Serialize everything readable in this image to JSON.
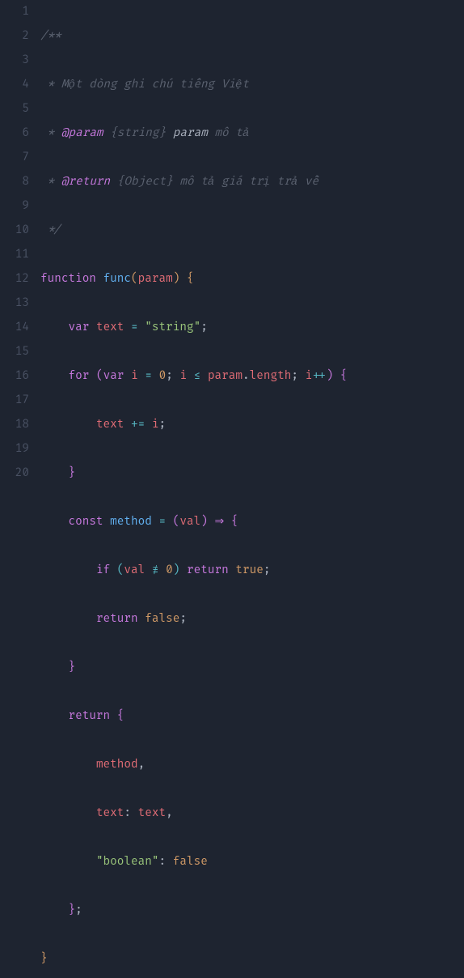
{
  "lines": {
    "n1": "1",
    "n2": "2",
    "n3": "3",
    "n4": "4",
    "n5": "5",
    "n6": "6",
    "n7": "7",
    "n8": "8",
    "n9": "9",
    "n10": "10",
    "n11": "11",
    "n12": "12",
    "n13": "13",
    "n14": "14",
    "n15": "15",
    "n16": "16",
    "n17": "17",
    "n18": "18",
    "n19": "19",
    "n20": "20"
  },
  "t": {
    "l1a": "/**",
    "l2a": " * Một dòng ghi chú tiếng Việt",
    "l3a": " * ",
    "l3b": "@param",
    "l3c": " ",
    "l3d": "{string}",
    "l3e": " ",
    "l3f": "param",
    "l3g": " mô tả",
    "l4a": " * ",
    "l4b": "@return",
    "l4c": " ",
    "l4d": "{Object}",
    "l4e": " mô tả giá trị trả về",
    "l5a": " */",
    "l6a": "function",
    "l6b": " ",
    "l6c": "func",
    "l6d": "(",
    "l6e": "param",
    "l6f": ")",
    "l6g": " ",
    "l6h": "{",
    "l7a": "    ",
    "l7b": "var",
    "l7c": " ",
    "l7d": "text",
    "l7e": " ",
    "l7f": "=",
    "l7g": " ",
    "l7h": "\"string\"",
    "l7i": ";",
    "l8a": "    ",
    "l8b": "for",
    "l8c": " ",
    "l8d": "(",
    "l8e": "var",
    "l8f": " ",
    "l8g": "i",
    "l8h": " ",
    "l8i": "=",
    "l8j": " ",
    "l8k": "0",
    "l8l": ";",
    "l8m": " ",
    "l8n": "i",
    "l8o": " ",
    "l8p": "≤",
    "l8q": " ",
    "l8r": "param",
    "l8s": ".",
    "l8t": "length",
    "l8u": ";",
    "l8v": " ",
    "l8w": "i",
    "l8x": "++",
    "l8y": ")",
    "l8z": " ",
    "l8aa": "{",
    "l9a": "        ",
    "l9b": "text",
    "l9c": " ",
    "l9d": "+=",
    "l9e": " ",
    "l9f": "i",
    "l9g": ";",
    "l10a": "    ",
    "l10b": "}",
    "l11a": "    ",
    "l11b": "const",
    "l11c": " ",
    "l11d": "method",
    "l11e": " ",
    "l11f": "=",
    "l11g": " ",
    "l11h": "(",
    "l11i": "val",
    "l11j": ")",
    "l11k": " ",
    "l11l": "⇒",
    "l11m": " ",
    "l11n": "{",
    "l12a": "        ",
    "l12b": "if",
    "l12c": " ",
    "l12d": "(",
    "l12e": "val",
    "l12f": " ",
    "l12g": "≢",
    "l12h": " ",
    "l12i": "0",
    "l12j": ")",
    "l12k": " ",
    "l12l": "return",
    "l12m": " ",
    "l12n": "true",
    "l12o": ";",
    "l13a": "        ",
    "l13b": "return",
    "l13c": " ",
    "l13d": "false",
    "l13e": ";",
    "l14a": "    ",
    "l14b": "}",
    "l15a": "    ",
    "l15b": "return",
    "l15c": " ",
    "l15d": "{",
    "l16a": "        ",
    "l16b": "method",
    "l16c": ",",
    "l17a": "        ",
    "l17b": "text",
    "l17c": ":",
    "l17d": " ",
    "l17e": "text",
    "l17f": ",",
    "l18a": "        ",
    "l18b": "\"boolean\"",
    "l18c": ":",
    "l18d": " ",
    "l18e": "false",
    "l19a": "    ",
    "l19b": "}",
    "l19c": ";",
    "l20a": "}"
  }
}
